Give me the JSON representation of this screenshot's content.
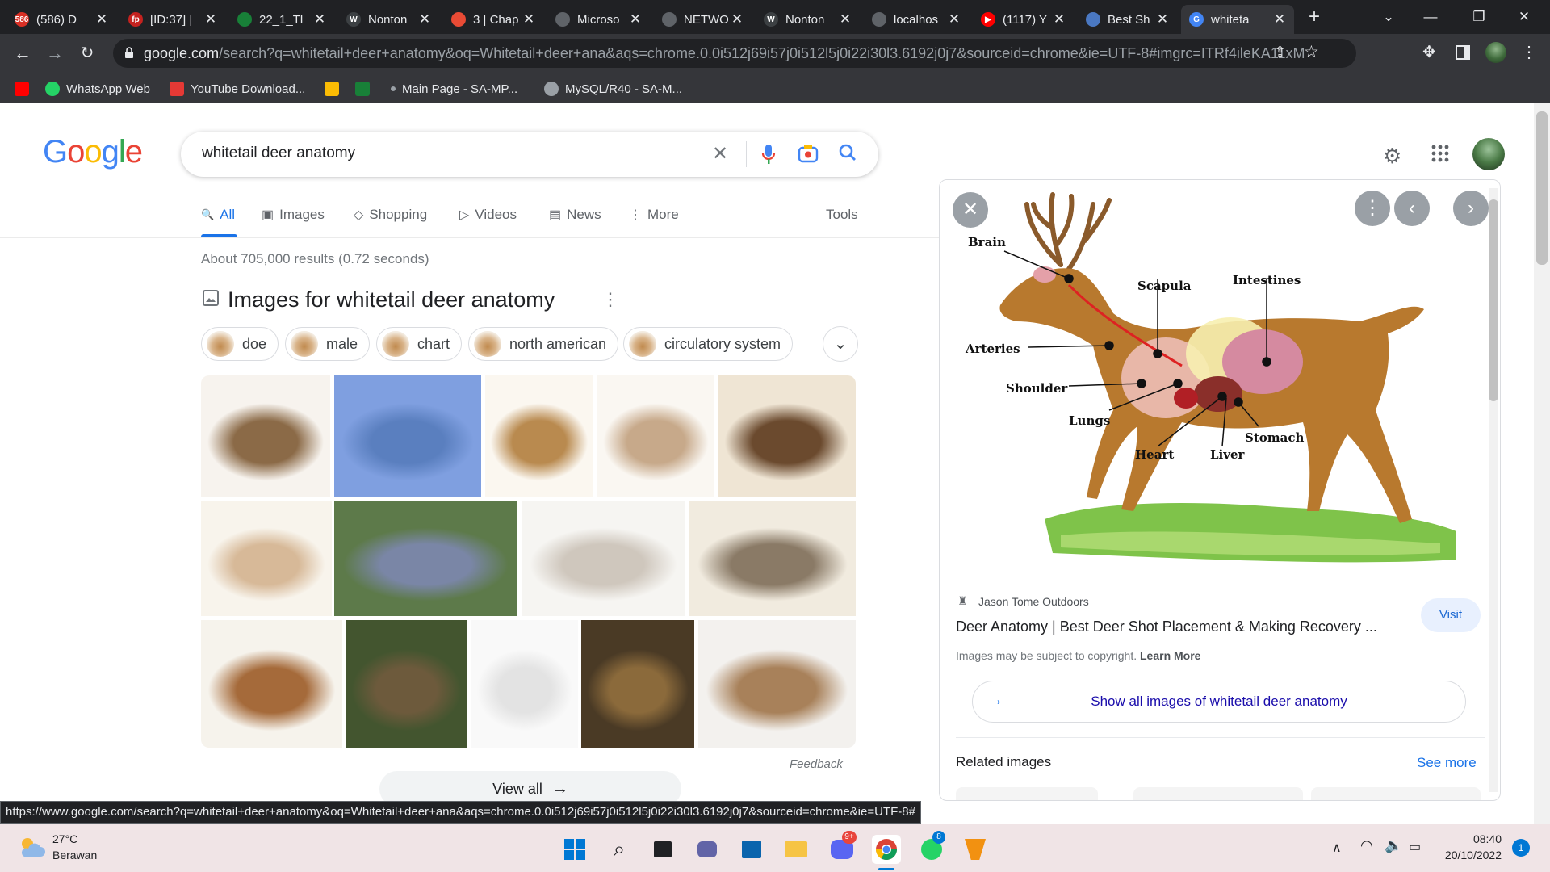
{
  "browser": {
    "tabs": [
      {
        "label": "(586) D",
        "favicon_color": "#d93025",
        "favicon_text": "586"
      },
      {
        "label": "[ID:37] |",
        "favicon_color": "#c5221f",
        "favicon_text": "fp"
      },
      {
        "label": "22_1_Tl",
        "favicon_color": "#188038",
        "favicon_text": ""
      },
      {
        "label": "Nonton",
        "favicon_color": "#3c4043",
        "favicon_text": "W"
      },
      {
        "label": "3 | Chap",
        "favicon_color": "#e94b35",
        "favicon_text": ""
      },
      {
        "label": "Microso",
        "favicon_color": "#5f6368",
        "favicon_text": ""
      },
      {
        "label": "NETWO",
        "favicon_color": "#5f6368",
        "favicon_text": ""
      },
      {
        "label": "Nonton",
        "favicon_color": "#3c4043",
        "favicon_text": "W"
      },
      {
        "label": "localhos",
        "favicon_color": "#5f6368",
        "favicon_text": ""
      },
      {
        "label": "(1117) Y",
        "favicon_color": "#ff0000",
        "favicon_text": "▶"
      },
      {
        "label": "Best Sh",
        "favicon_color": "#4a78c2",
        "favicon_text": ""
      },
      {
        "label": "whiteta",
        "favicon_color": "#4285f4",
        "favicon_text": "G"
      }
    ],
    "url_host": "google.com",
    "url_rest": "/search?q=whitetail+deer+anatomy&oq=Whitetail+deer+ana&aqs=chrome.0.0i512j69i57j0i512l5j0i22i30l3.6192j0j7&sourceid=chrome&ie=UTF-8#imgrc=ITRf4ileKA11xM",
    "bookmarks": [
      {
        "label": "",
        "icon": "youtube-icon",
        "color": "#ff0000"
      },
      {
        "label": "WhatsApp Web",
        "icon": "whatsapp-icon",
        "color": "#25d366"
      },
      {
        "label": "YouTube Download...",
        "icon": "download-icon",
        "color": "#e53935"
      },
      {
        "label": "",
        "icon": "drive-icon",
        "color": "#fbbc04"
      },
      {
        "label": "",
        "icon": "docs-icon",
        "color": "#188038"
      },
      {
        "label": "Main Page - SA-MP...",
        "icon": "dot-icon",
        "color": "#9aa0a6"
      },
      {
        "label": "MySQL/R40 - SA-M...",
        "icon": "globe-icon",
        "color": "#9aa0a6"
      }
    ]
  },
  "google": {
    "logo": "Google",
    "query": "whitetail deer anatomy",
    "tabs": [
      {
        "label": "All",
        "icon": "search-icon"
      },
      {
        "label": "Images",
        "icon": "image-icon"
      },
      {
        "label": "Shopping",
        "icon": "tag-icon"
      },
      {
        "label": "Videos",
        "icon": "video-icon"
      },
      {
        "label": "News",
        "icon": "news-icon"
      },
      {
        "label": "More",
        "icon": "more-vert-icon"
      }
    ],
    "tools": "Tools",
    "result_stats": "About 705,000 results (0.72 seconds)",
    "images_heading": "Images for whitetail deer anatomy",
    "chips": [
      "doe",
      "male",
      "chart",
      "north american",
      "circulatory system"
    ],
    "view_all": "View all",
    "feedback": "Feedback"
  },
  "panel": {
    "diagram_labels": [
      "Brain",
      "Scapula",
      "Intestines",
      "Arteries",
      "Shoulder",
      "Lungs",
      "Stomach",
      "Heart",
      "Liver"
    ],
    "source": "Jason Tome Outdoors",
    "title": "Deer Anatomy | Best Deer Shot Placement & Making Recovery ...",
    "visit": "Visit",
    "copyright": "Images may be subject to copyright.",
    "learn_more": "Learn More",
    "show_all": "Show all images of whitetail deer anatomy",
    "related": "Related images",
    "see_more": "See more"
  },
  "status_url": "https://www.google.com/search?q=whitetail+deer+anatomy&oq=Whitetail+deer+ana&aqs=chrome.0.0i512j69i57j0i512l5j0i22i30l3.6192j0j7&sourceid=chrome&ie=UTF-8#",
  "taskbar": {
    "weather_temp": "27°C",
    "weather_desc": "Berawan",
    "time": "08:40",
    "date": "20/10/2022",
    "notification_count": "1",
    "discord_badge": "9+",
    "whatsapp_badge": "8"
  }
}
